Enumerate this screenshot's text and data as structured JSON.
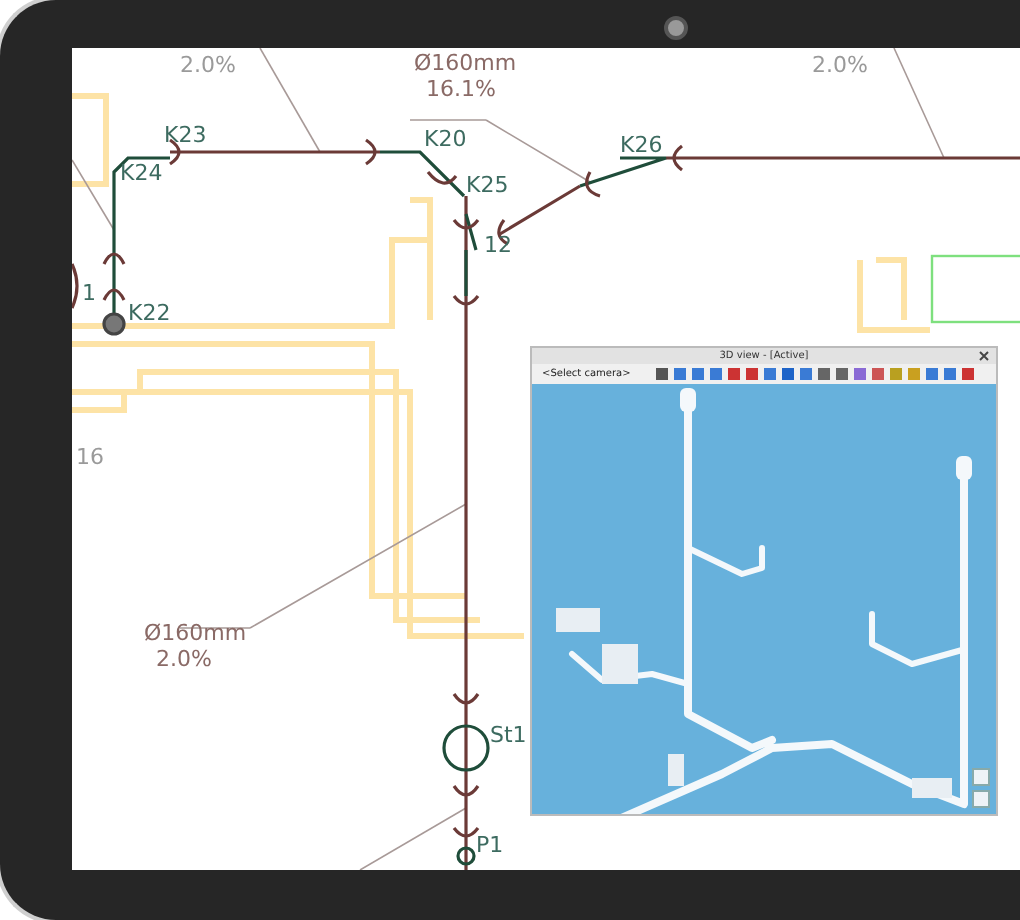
{
  "drawing": {
    "node_labels": [
      "K23",
      "K24",
      "K20",
      "K25",
      "K26",
      "12",
      "K22",
      "1",
      "St1",
      "P1"
    ],
    "pipe_labels": [
      {
        "size": "Ø160mm",
        "slope": "16.1%"
      },
      {
        "size": "Ø160mm",
        "slope": "2.0%"
      }
    ],
    "cut_labels": [
      "2.0%",
      "2.0%",
      "16"
    ]
  },
  "view_3d": {
    "title": "3D view - [Active]",
    "camera": "<Select camera>"
  }
}
